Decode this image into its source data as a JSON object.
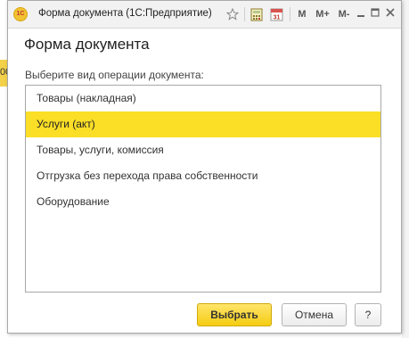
{
  "background": {
    "strip_text": "00",
    "strip_color": "#f3d24a"
  },
  "window": {
    "title": "Форма документа  (1С:Предприятие)",
    "app_icon": "1c-logo-icon",
    "toolbar": {
      "favorite_icon": "star-icon",
      "calculator_icon": "calculator-icon",
      "calendar_icon": "calendar-icon",
      "calendar_label": "31",
      "m_label": "M",
      "m_plus_label": "M+",
      "m_minus_label": "M-",
      "minimize_icon": "minimize-icon",
      "maximize_icon": "maximize-icon",
      "close_icon": "close-icon"
    }
  },
  "form": {
    "heading": "Форма документа",
    "prompt": "Выберите вид операции документа:",
    "options": [
      {
        "label": "Товары (накладная)",
        "selected": false
      },
      {
        "label": "Услуги (акт)",
        "selected": true
      },
      {
        "label": "Товары, услуги, комиссия",
        "selected": false
      },
      {
        "label": "Отгрузка без перехода права собственности",
        "selected": false
      },
      {
        "label": "Оборудование",
        "selected": false
      }
    ],
    "select_button": "Выбрать",
    "cancel_button": "Отмена",
    "help_button": "?"
  },
  "colors": {
    "accent": "#fbde26",
    "primary_button": "#f5cd12"
  }
}
